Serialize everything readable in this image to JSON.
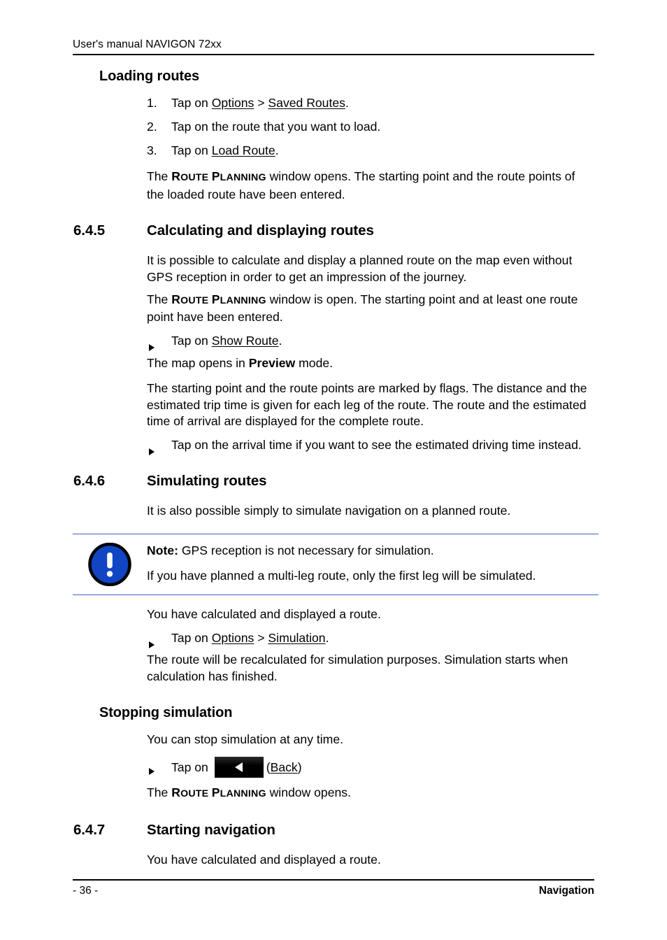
{
  "document": {
    "header_text": "User's manual NAVIGON 72xx",
    "footer_page": "- 36 -",
    "footer_chapter": "Navigation",
    "note_rule_color": "#3a62c4",
    "note_icon_color": "#1145c4"
  },
  "sections": {
    "loading_routes": {
      "heading": "Loading routes",
      "steps": [
        {
          "num": "1.",
          "pre": "Tap on ",
          "link1": "Options",
          "mid": " > ",
          "link2": "Saved Routes",
          "post": "."
        },
        {
          "num": "2.",
          "text": "Tap on the route that you want to load."
        },
        {
          "num": "3.",
          "pre": "Tap on ",
          "link1": "Load Route",
          "post": "."
        }
      ],
      "result_pre": "The ",
      "result_window_a": "Route",
      "result_window_b": "Planning",
      "result_post": " window opens. The starting point and the route points of the loaded route have been entered."
    },
    "calculating": {
      "number": "6.4.5",
      "heading": "Calculating and displaying routes",
      "para1": "It is possible to calculate and display a planned route on the map even without GPS reception in order to get an impression of the journey.",
      "para2_pre": "The ",
      "para2_window_a": "Route",
      "para2_window_b": "Planning",
      "para2_post": " window is open. The starting point and at least one route point have been entered.",
      "bullet1_pre": "Tap on ",
      "bullet1_link": "Show Route",
      "bullet1_post": ".",
      "result1_pre": "The map opens in ",
      "result1_bold": "Preview",
      "result1_post": " mode.",
      "result2": "The starting point and the route points are marked by flags. The distance and the estimated trip time is given for each leg of the route. The route and the estimated time of arrival are displayed for the complete route.",
      "bullet2": "Tap on the arrival time if you want to see the estimated driving time instead."
    },
    "simulating": {
      "number": "6.4.6",
      "heading": "Simulating routes",
      "intro": "It is also possible simply to simulate navigation on a planned route.",
      "note": {
        "icon_name": "exclamation-icon",
        "label": "Note:",
        "line1": " GPS reception is not necessary for simulation.",
        "line2": "If you have planned a multi-leg route, only the first leg will be simulated."
      },
      "precondition": "You have calculated and displayed a route.",
      "bullet_pre": "Tap on ",
      "bullet_link1": "Options",
      "bullet_mid": " > ",
      "bullet_link2": "Simulation",
      "bullet_post": ".",
      "result": "The route will be recalculated for simulation purposes. Simulation starts when calculation has finished."
    },
    "stopping_simulation": {
      "heading": "Stopping simulation",
      "intro": "You can stop simulation at any time.",
      "bullet_pre": "Tap on ",
      "button_icon_name": "back-button-icon",
      "bullet_paren_open": "(",
      "bullet_link": "Back",
      "bullet_paren_close": ")",
      "result_pre": "The ",
      "result_window_a": "Route",
      "result_window_b": "Planning",
      "result_post": " window opens."
    },
    "starting_navigation": {
      "number": "6.4.7",
      "heading": "Starting navigation",
      "precondition": "You have calculated and displayed a route."
    }
  }
}
